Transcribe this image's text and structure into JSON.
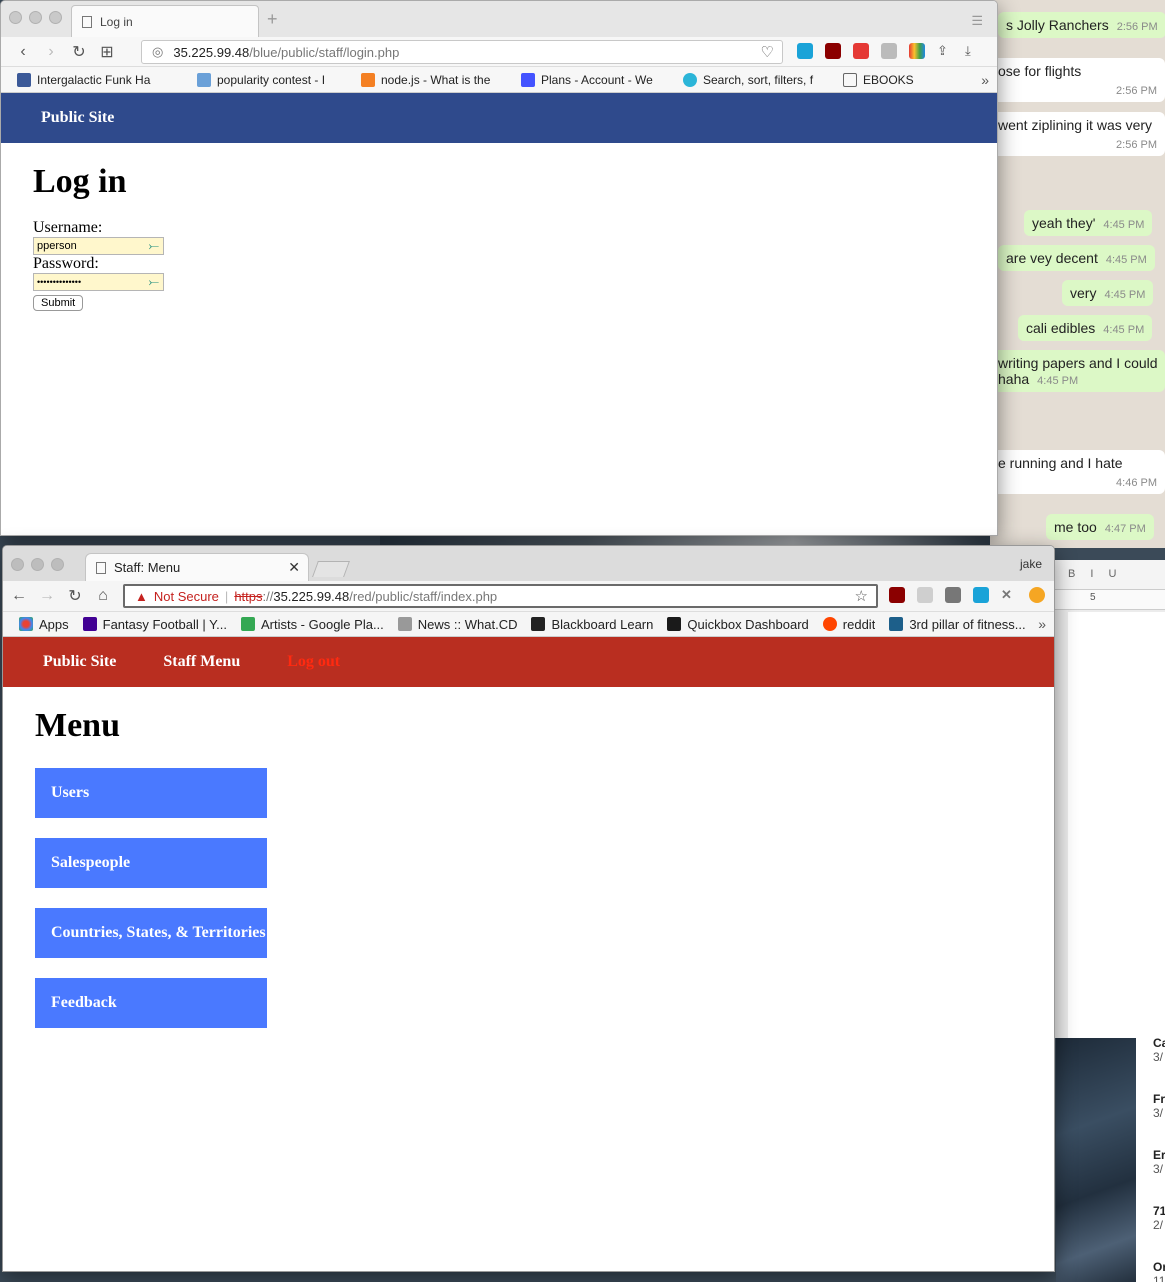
{
  "chat": {
    "messages": [
      {
        "text": "s Jolly Ranchers",
        "time": "2:56 PM",
        "dir": "out"
      },
      {
        "text": "ose for flights",
        "time": "2:56 PM",
        "dir": "in"
      },
      {
        "text": "went ziplining it was very",
        "time": "2:56 PM",
        "dir": "in"
      },
      {
        "text": "yeah they'",
        "time": "4:45 PM",
        "dir": "out"
      },
      {
        "text": "are vey decent",
        "time": "4:45 PM",
        "dir": "out"
      },
      {
        "text": "very",
        "time": "4:45 PM",
        "dir": "out"
      },
      {
        "text": "cali edibles",
        "time": "4:45 PM",
        "dir": "out"
      },
      {
        "text": "writing papers and I could",
        "text2": "haha",
        "time": "4:45 PM",
        "dir": "out"
      },
      {
        "text": "e running and I hate",
        "time": "4:46 PM",
        "dir": "in"
      },
      {
        "text": "me too",
        "time": "4:47 PM",
        "dir": "out"
      }
    ]
  },
  "calendar": {
    "items": [
      {
        "title": "Ca",
        "date": "3/"
      },
      {
        "title": "Fr",
        "date": "3/"
      },
      {
        "title": "Er",
        "date": "3/"
      },
      {
        "title": "71",
        "date": "2/"
      },
      {
        "title": "Or",
        "date": "11"
      }
    ]
  },
  "word": {
    "ruler_mark": "5",
    "toolbar": "B I U"
  },
  "window1": {
    "tab_title": "Log in",
    "url_host": "35.225.99.48",
    "url_path": "/blue/public/staff/login.php",
    "bookmarks": [
      {
        "label": "Intergalactic Funk Ha",
        "color": "#3b5998"
      },
      {
        "label": "popularity contest - I",
        "color": "#6aa0d8"
      },
      {
        "label": "node.js - What is the",
        "color": "#f48024"
      },
      {
        "label": "Plans - Account - We",
        "color": "#4353ff"
      },
      {
        "label": "Search, sort, filters, f",
        "color": "#2bb5d8"
      },
      {
        "label": "EBOOKS",
        "color": "#888888"
      }
    ],
    "more": "»",
    "page": {
      "nav": {
        "public_site": "Public Site"
      },
      "title": "Log in",
      "username_label": "Username:",
      "username_value": "pperson",
      "password_label": "Password:",
      "password_value": "••••••••••••••",
      "submit_label": "Submit"
    },
    "header_color": "#2f4a8c"
  },
  "window2": {
    "tab_title": "Staff: Menu",
    "user": "jake",
    "security_label": "Not Secure",
    "url_scheme": "https",
    "url_host": "35.225.99.48",
    "url_path": "/red/public/staff/index.php",
    "bookmarks": [
      {
        "label": "Apps",
        "color": "#e94235"
      },
      {
        "label": "Fantasy Football | Y...",
        "color": "#410093"
      },
      {
        "label": "Artists - Google Pla...",
        "color": "#34a853"
      },
      {
        "label": "News :: What.CD",
        "color": "#999999"
      },
      {
        "label": "Blackboard Learn",
        "color": "#222222"
      },
      {
        "label": "Quickbox Dashboard",
        "color": "#1a1a1a"
      },
      {
        "label": "reddit",
        "color": "#ff4500"
      },
      {
        "label": "3rd pillar of fitness...",
        "color": "#1d5f8a"
      }
    ],
    "more": "»",
    "page": {
      "nav": {
        "public_site": "Public Site",
        "staff_menu": "Staff Menu",
        "logout": "Log out"
      },
      "title": "Menu",
      "menu_items": [
        "Users",
        "Salespeople",
        "Countries, States, & Territories",
        "Feedback"
      ]
    },
    "header_color": "#b92e20",
    "menu_color": "#4a79ff"
  }
}
